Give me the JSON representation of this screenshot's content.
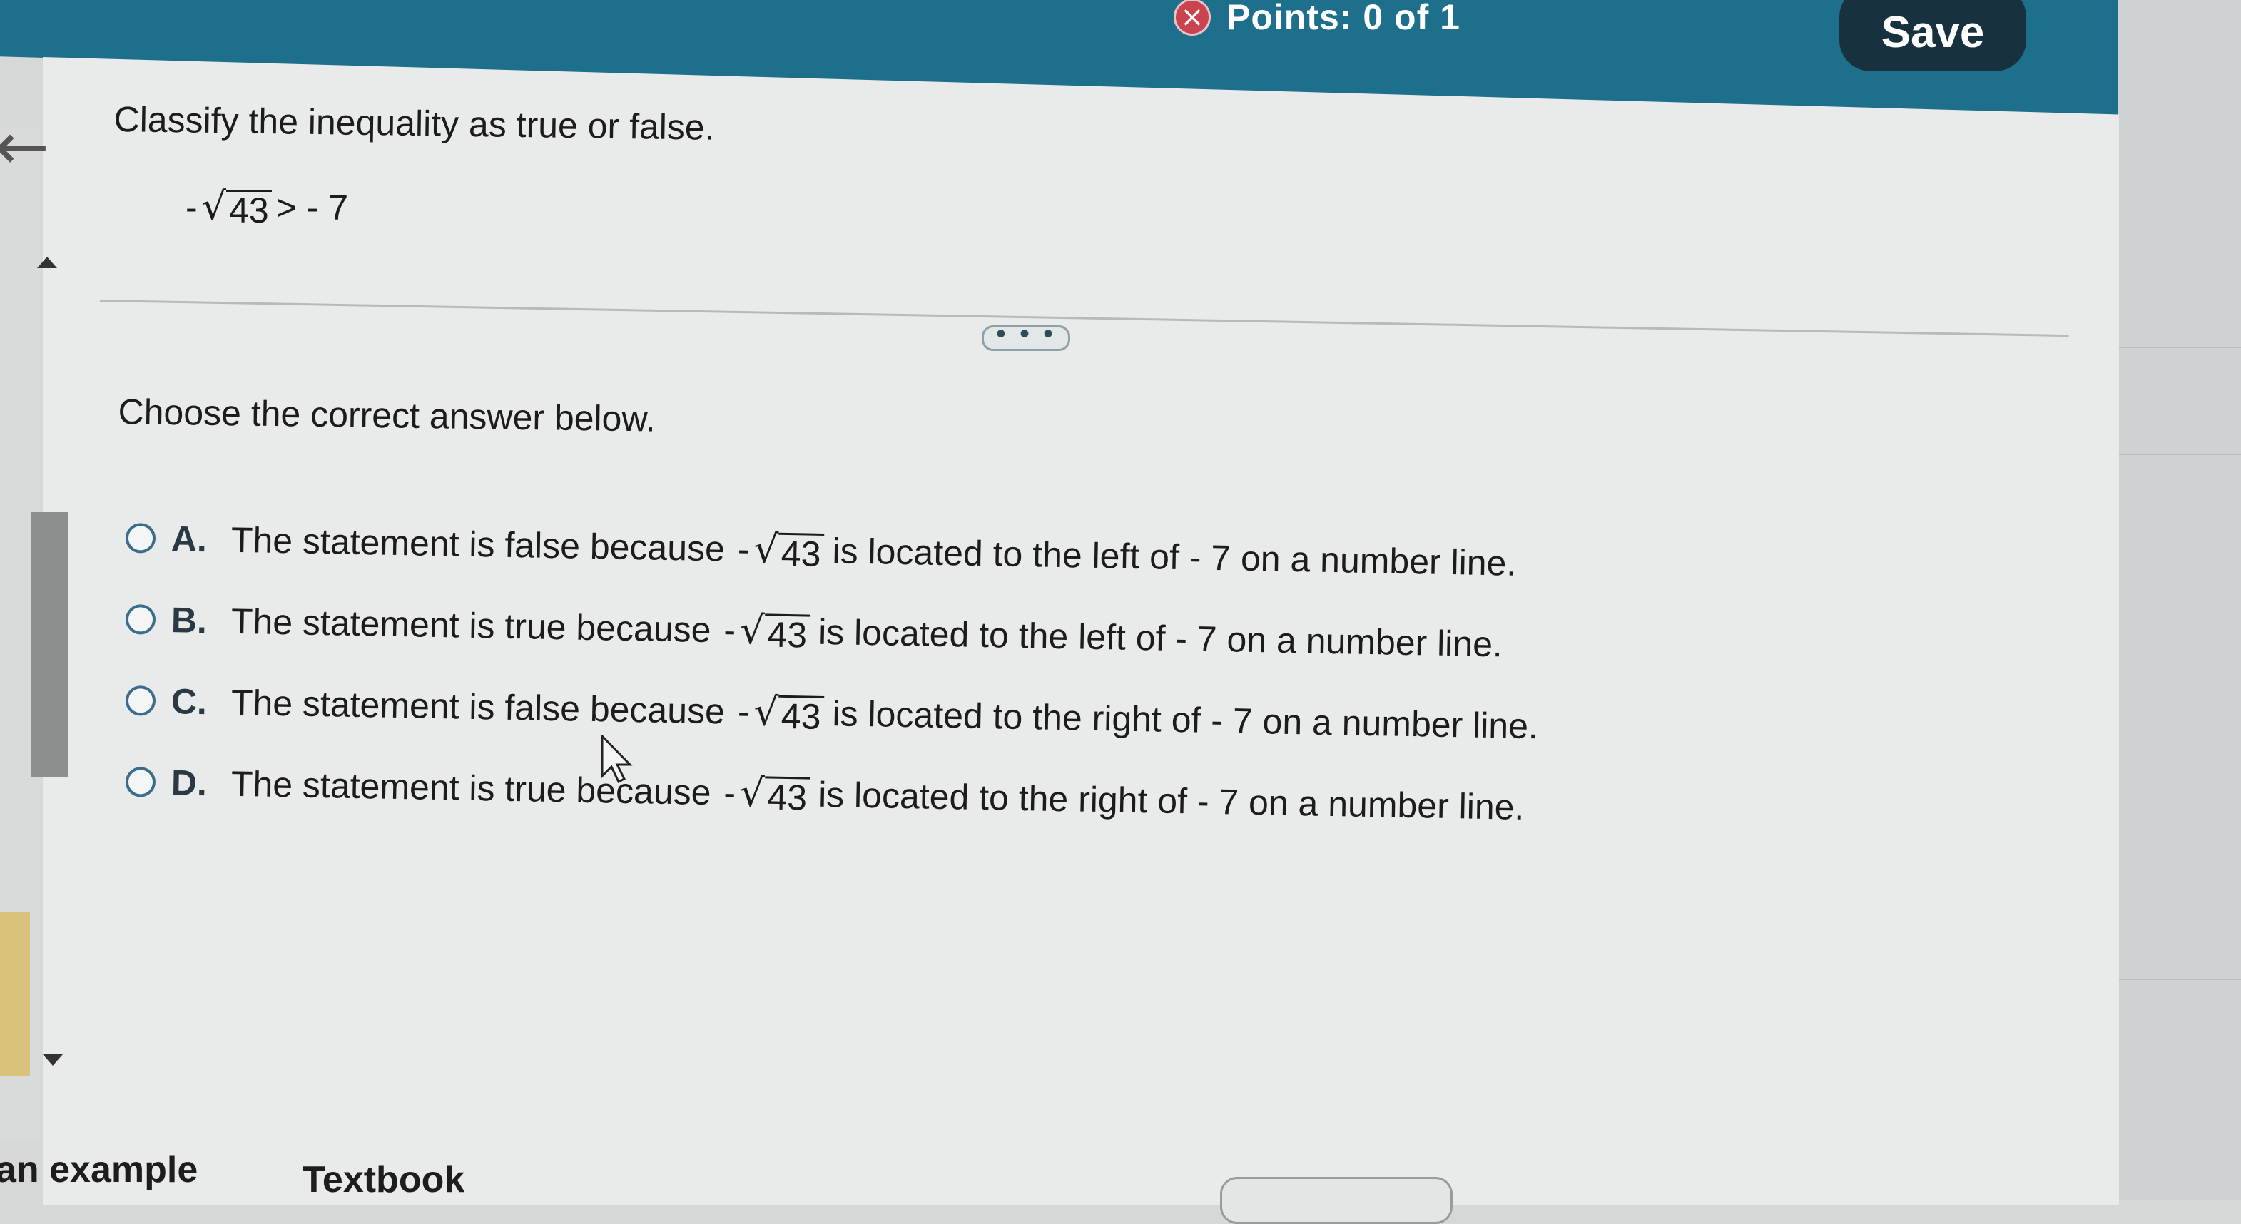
{
  "header": {
    "points_label": "Points:",
    "points_value": "0 of 1",
    "save_label": "Save",
    "incorrect_icon": "x-circle-icon"
  },
  "question": {
    "prompt": "Classify the inequality as true or false.",
    "inequality": {
      "prefix": "-",
      "radicand": "43",
      "rest": "> - 7"
    }
  },
  "more_button_label": "• • •",
  "instruction": "Choose the correct answer below.",
  "options": [
    {
      "letter": "A.",
      "pre": "The statement is false because",
      "radicand": "43",
      "post": "is located to the left of  - 7 on a number line."
    },
    {
      "letter": "B.",
      "pre": "The statement is true because",
      "radicand": "43",
      "post": "is located to the left of  - 7 on a number line."
    },
    {
      "letter": "C.",
      "pre": "The statement is false because",
      "radicand": "43",
      "post": "is located to the right of  - 7 on a number line."
    },
    {
      "letter": "D.",
      "pre": "The statement is true because",
      "radicand": "43",
      "post": "is located to the right of  - 7 on a number line."
    }
  ],
  "bottom": {
    "link1": "an example",
    "link2": "Textbook"
  },
  "colors": {
    "header": "#1e6f8c",
    "save_button": "#17313e",
    "radio": "#3a6d8c",
    "incorrect_badge": "#c9444f"
  }
}
